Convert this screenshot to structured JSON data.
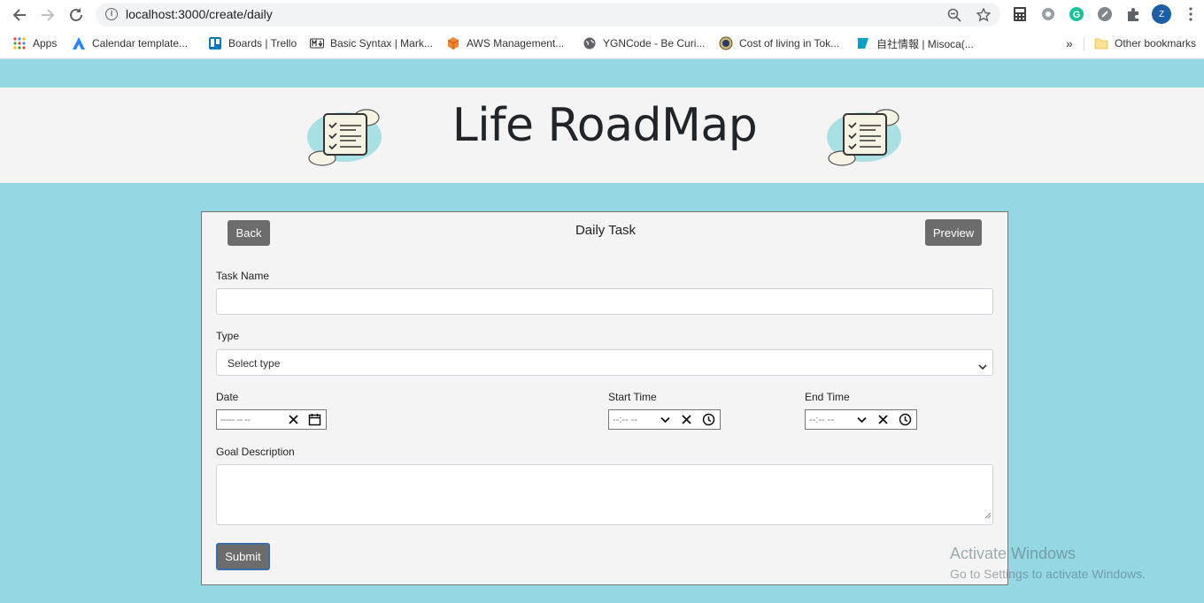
{
  "browser": {
    "url": "localhost:3000/create/daily",
    "bookmarks": [
      "Apps",
      "Calendar template...",
      "Boards | Trello",
      "Basic Syntax | Mark...",
      "AWS Management...",
      "YGNCode - Be Curi...",
      "Cost of living in Tok...",
      "自社情報 | Misoca(..."
    ],
    "other_bookmarks": "Other bookmarks",
    "overflow": "»",
    "profile_initial": "Z"
  },
  "header": {
    "title": "Life RoadMap"
  },
  "form": {
    "back_label": "Back",
    "title": "Daily Task",
    "preview_label": "Preview",
    "task_name_label": "Task Name",
    "type_label": "Type",
    "type_value": "Select type",
    "date_label": "Date",
    "date_placeholder": "----- -- --",
    "start_time_label": "Start Time",
    "end_time_label": "End Time",
    "time_placeholder": "--:--  --",
    "goal_description_label": "Goal Description",
    "submit_label": "Submit"
  },
  "watermark": {
    "line1": "Activate Windows",
    "line2": "Go to Settings to activate Windows."
  },
  "colors": {
    "page_bg": "#93d8e3",
    "header_bg": "#f4f4f4",
    "button_bg": "#6c6c6c",
    "profile": "#1a5fa8"
  }
}
